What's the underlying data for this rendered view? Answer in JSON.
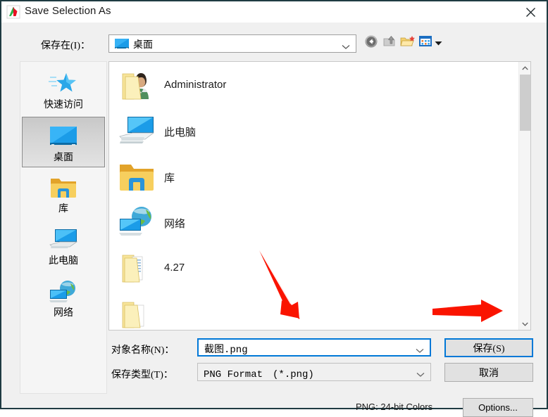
{
  "window": {
    "title": "Save Selection As",
    "app_icon": "app-logo-icon",
    "close_label": "✕"
  },
  "toolbar": {
    "lookin_label": "保存在(I)：",
    "current_folder": "桌面",
    "buttons": [
      {
        "name": "back-button",
        "icon": "back-arrow-icon"
      },
      {
        "name": "up-one-level-button",
        "icon": "up-folder-icon"
      },
      {
        "name": "new-folder-button",
        "icon": "new-folder-icon"
      },
      {
        "name": "views-button",
        "icon": "views-grid-icon"
      }
    ]
  },
  "places": {
    "items": [
      {
        "label": "快速访问",
        "icon": "star-icon",
        "selected": false
      },
      {
        "label": "桌面",
        "icon": "monitor-icon",
        "selected": true
      },
      {
        "label": "库",
        "icon": "library-folder-icon",
        "selected": false
      },
      {
        "label": "此电脑",
        "icon": "computer-icon",
        "selected": false
      },
      {
        "label": "网络",
        "icon": "network-globe-icon",
        "selected": false
      }
    ]
  },
  "filelist": {
    "items": [
      {
        "label": "Administrator",
        "icon": "user-folder-icon"
      },
      {
        "label": "此电脑",
        "icon": "computer-icon"
      },
      {
        "label": "库",
        "icon": "library-folder-icon"
      },
      {
        "label": "网络",
        "icon": "network-globe-icon"
      },
      {
        "label": "4.27",
        "icon": "folder-docs-icon"
      },
      {
        "label": "",
        "icon": "folder-icon"
      }
    ]
  },
  "form": {
    "name_label": "对象名称(N)：",
    "name_value": "截图.png",
    "type_label": "保存类型(T)：",
    "type_value": "PNG Format　(*.png)"
  },
  "buttons": {
    "save": "保存(S)",
    "cancel": "取消",
    "options": "Options..."
  },
  "status": {
    "format_info": "PNG: 24-bit Colors"
  },
  "colors": {
    "accent": "#0078d7",
    "annotation": "#fa1400",
    "window_bg": "#f0f0f0",
    "titlebar_border": "#1f3b42"
  }
}
